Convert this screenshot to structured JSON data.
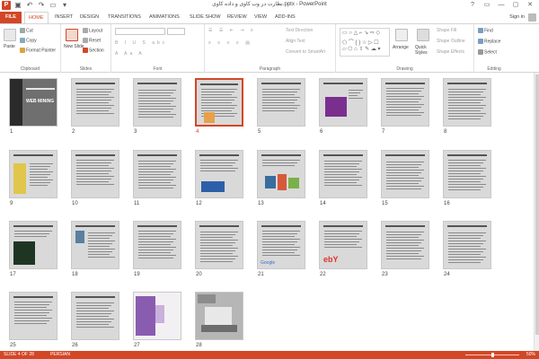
{
  "window": {
    "title": "نظارت در وب کاوی و داده کاوی.pptx - PowerPoint",
    "controls": [
      "?",
      "▭",
      "—",
      "▢",
      "✕"
    ]
  },
  "tabs": [
    {
      "label": "FILE"
    },
    {
      "label": "HOME"
    },
    {
      "label": "INSERT"
    },
    {
      "label": "DESIGN"
    },
    {
      "label": "TRANSITIONS"
    },
    {
      "label": "ANIMATIONS"
    },
    {
      "label": "SLIDE SHOW"
    },
    {
      "label": "REVIEW"
    },
    {
      "label": "VIEW"
    },
    {
      "label": "ADD-INS"
    }
  ],
  "signin": "Sign in",
  "ribbon": {
    "clipboard": {
      "label": "Clipboard",
      "paste": "Paste",
      "cut": "Cut",
      "copy": "Copy",
      "format_painter": "Format Painter"
    },
    "slides": {
      "label": "Slides",
      "new_slide": "New Slide",
      "layout": "Layout",
      "reset": "Reset",
      "section": "Section"
    },
    "font": {
      "label": "Font"
    },
    "paragraph": {
      "label": "Paragraph",
      "text_direction": "Text Direction",
      "align_text": "Align Text",
      "convert": "Convert to SmartArt"
    },
    "drawing": {
      "label": "Drawing",
      "arrange": "Arrange",
      "quick_styles": "Quick Styles",
      "shape_fill": "Shape Fill",
      "shape_outline": "Shape Outline",
      "shape_effects": "Shape Effects"
    },
    "editing": {
      "label": "Editing",
      "find": "Find",
      "replace": "Replace",
      "select": "Select"
    }
  },
  "slides": [
    {
      "n": "1",
      "kind": "cover"
    },
    {
      "n": "2",
      "kind": "text"
    },
    {
      "n": "3",
      "kind": "text"
    },
    {
      "n": "4",
      "kind": "text-img",
      "selected": true
    },
    {
      "n": "5",
      "kind": "text"
    },
    {
      "n": "6",
      "kind": "img-purple"
    },
    {
      "n": "7",
      "kind": "text"
    },
    {
      "n": "8",
      "kind": "text"
    },
    {
      "n": "9",
      "kind": "img-yellow"
    },
    {
      "n": "10",
      "kind": "text"
    },
    {
      "n": "11",
      "kind": "text"
    },
    {
      "n": "12",
      "kind": "img-blue"
    },
    {
      "n": "13",
      "kind": "img-mixed"
    },
    {
      "n": "14",
      "kind": "text"
    },
    {
      "n": "15",
      "kind": "text"
    },
    {
      "n": "16",
      "kind": "text"
    },
    {
      "n": "17",
      "kind": "img-dark"
    },
    {
      "n": "18",
      "kind": "img-small"
    },
    {
      "n": "19",
      "kind": "text"
    },
    {
      "n": "20",
      "kind": "text"
    },
    {
      "n": "21",
      "kind": "img-google"
    },
    {
      "n": "22",
      "kind": "img-ebay"
    },
    {
      "n": "23",
      "kind": "text"
    },
    {
      "n": "24",
      "kind": "text"
    },
    {
      "n": "25",
      "kind": "text"
    },
    {
      "n": "26",
      "kind": "text"
    },
    {
      "n": "27",
      "kind": "img-flower"
    },
    {
      "n": "28",
      "kind": "img-laptop"
    }
  ],
  "thumb_text": {
    "web_mining": "WEB MINING",
    "google": "Google",
    "ebay": "ebY"
  },
  "status": {
    "slide": "SLIDE 4 OF 28",
    "language": "PERSIAN",
    "zoom": "50%"
  },
  "colors": {
    "accent": "#d24726",
    "slide_bg": "#d9d9d9"
  }
}
